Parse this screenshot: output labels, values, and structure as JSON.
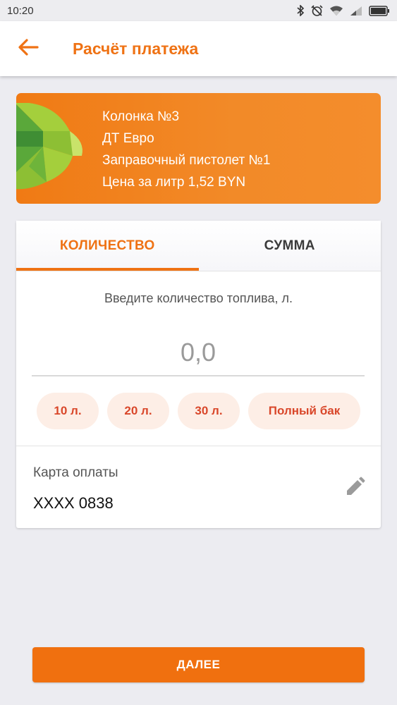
{
  "status_bar": {
    "time": "10:20",
    "icons": [
      "bluetooth-icon",
      "alarm-off-icon",
      "wifi-icon",
      "cell-signal-icon",
      "battery-icon"
    ]
  },
  "app_bar": {
    "title": "Расчёт платежа",
    "back_icon": "arrow-back-icon",
    "accent_color": "#ef7214"
  },
  "station": {
    "pump": "Колонка №3",
    "fuel": "ДТ Евро",
    "nozzle": "Заправочный пистолет №1",
    "price": "Цена за литр 1,52 BYN",
    "banner_color": "#f07a14"
  },
  "tabs": {
    "items": [
      {
        "label": "КОЛИЧЕСТВО",
        "active": true
      },
      {
        "label": "СУММА",
        "active": false
      }
    ]
  },
  "quantity": {
    "prompt": "Введите количество топлива, л.",
    "placeholder": "0,0",
    "value": ""
  },
  "presets": [
    "10 л.",
    "20 л.",
    "30 л.",
    "Полный бак"
  ],
  "payment": {
    "label": "Карта оплаты",
    "card": "XXXX 0838",
    "edit_icon": "pencil-icon"
  },
  "next_button": {
    "label": "ДАЛЕЕ"
  }
}
